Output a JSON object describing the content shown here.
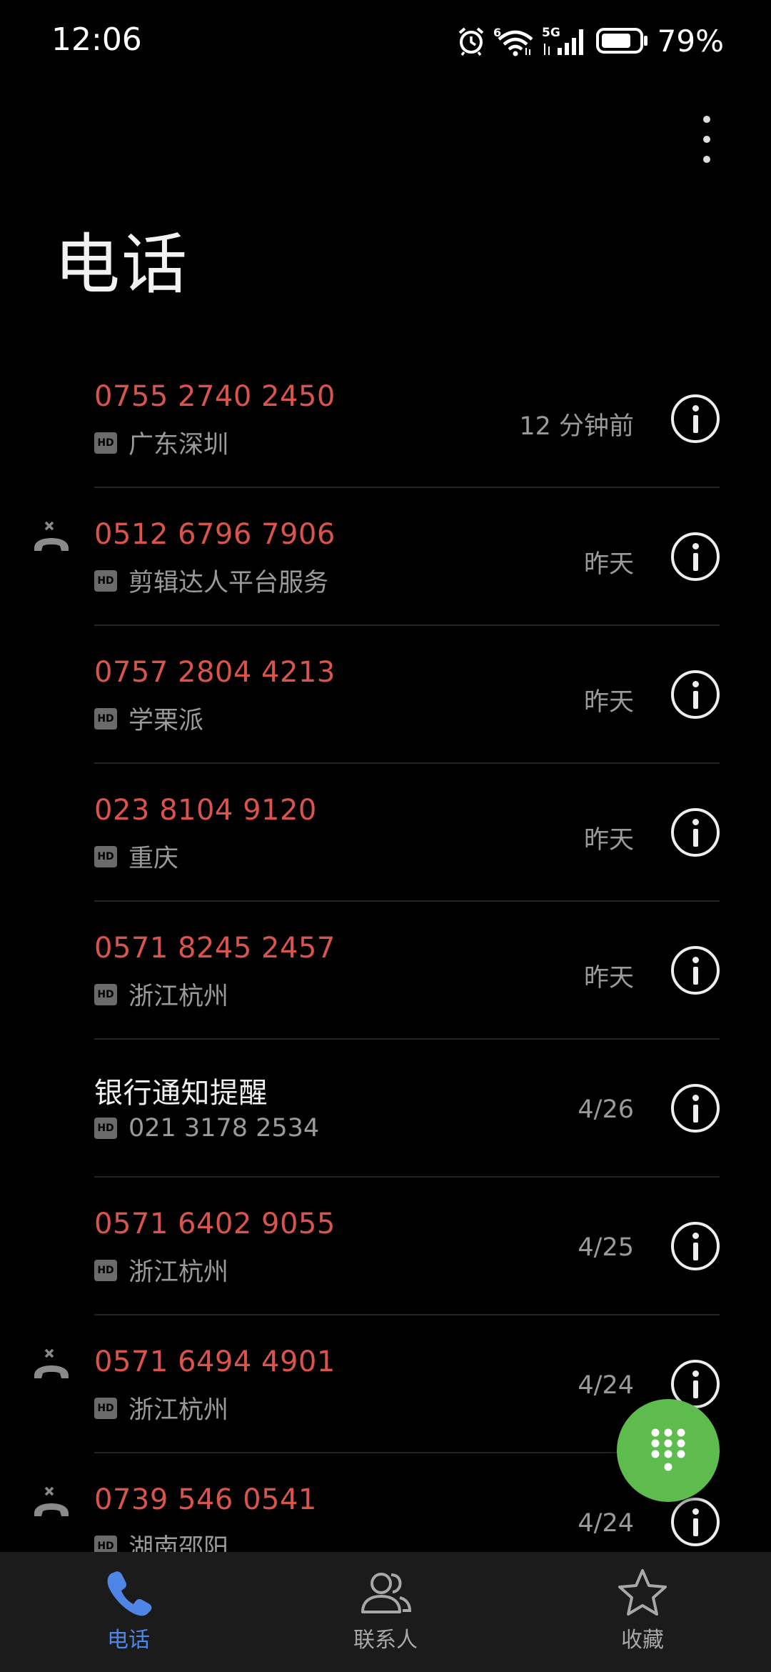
{
  "status_bar": {
    "time": "12:06",
    "signal_label": "5G",
    "wifi_label": "6",
    "battery_percent": "79%",
    "battery_level": 0.79,
    "icons": [
      "alarm-icon",
      "wifi-icon",
      "signal-icon",
      "battery-icon"
    ]
  },
  "page": {
    "title": "电话"
  },
  "calls": [
    {
      "number": "0755 2740 2450",
      "subtitle": "广东深圳",
      "time": "12 分钟前",
      "missed": false,
      "named": false
    },
    {
      "number": "0512 6796 7906",
      "subtitle": "剪辑达人平台服务",
      "time": "昨天",
      "missed": true,
      "named": false
    },
    {
      "number": "0757 2804 4213",
      "subtitle": "学栗派",
      "time": "昨天",
      "missed": false,
      "named": false
    },
    {
      "number": "023 8104 9120",
      "subtitle": "重庆",
      "time": "昨天",
      "missed": false,
      "named": false
    },
    {
      "number": "0571 8245 2457",
      "subtitle": "浙江杭州",
      "time": "昨天",
      "missed": false,
      "named": false
    },
    {
      "number": "银行通知提醒",
      "subtitle": "021 3178 2534",
      "time": "4/26",
      "missed": false,
      "named": true
    },
    {
      "number": "0571 6402 9055",
      "subtitle": "浙江杭州",
      "time": "4/25",
      "missed": false,
      "named": false
    },
    {
      "number": "0571 6494 4901",
      "subtitle": "浙江杭州",
      "time": "4/24",
      "missed": true,
      "named": false
    },
    {
      "number": "0739 546 0541",
      "subtitle": "湖南邵阳",
      "time": "4/24",
      "missed": true,
      "named": false
    }
  ],
  "hd_badge": "HD",
  "nav": [
    {
      "label": "电话",
      "icon": "phone-icon",
      "active": true
    },
    {
      "label": "联系人",
      "icon": "contacts-icon",
      "active": false
    },
    {
      "label": "收藏",
      "icon": "star-icon",
      "active": false
    }
  ],
  "colors": {
    "missed_number": "#d9544d",
    "accent": "#4f86e6",
    "fab": "#5ebc4f"
  }
}
